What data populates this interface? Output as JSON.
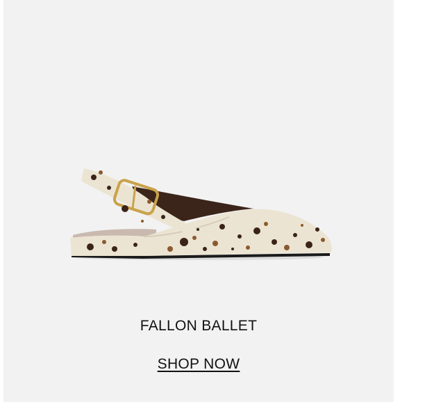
{
  "product": {
    "name": "FALLON BALLET",
    "cta_label": "SHOP NOW",
    "image_icon": "slingback-flat-shoe-image"
  },
  "colors": {
    "card_background": "#f2f2f2",
    "text": "#111111",
    "shoe_base": "#ece4d3",
    "spot_dark": "#3a2418",
    "spot_brown": "#8a5a2e",
    "buckle_gold": "#c9a24a"
  }
}
